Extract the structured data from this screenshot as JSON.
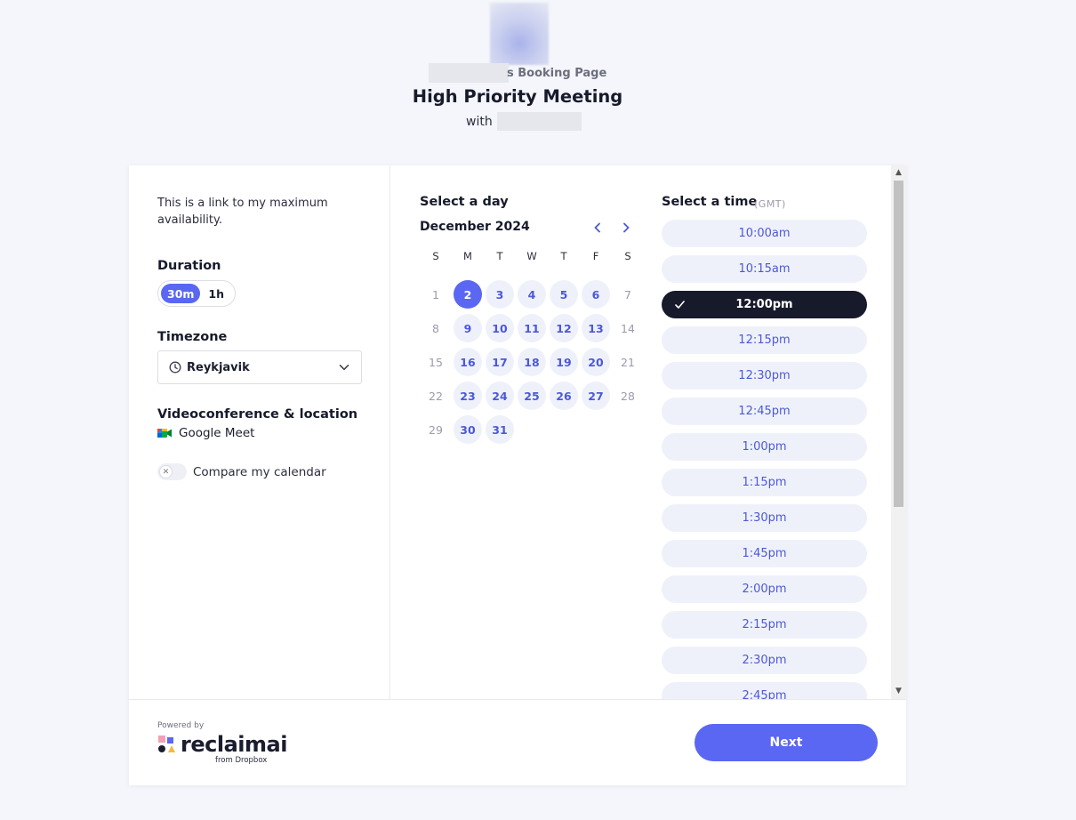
{
  "header": {
    "booking_page_title": "s Booking Page",
    "meeting_title": "High Priority Meeting",
    "with_label": "with"
  },
  "left": {
    "description": "This is a link to my maximum availability.",
    "duration_label": "Duration",
    "duration_options": [
      "30m",
      "1h"
    ],
    "duration_selected": "30m",
    "timezone_label": "Timezone",
    "timezone_value": "Reykjavik",
    "video_label": "Videoconference & location",
    "video_value": "Google Meet",
    "compare_label": "Compare my calendar"
  },
  "calendar": {
    "title": "Select a day",
    "month": "December 2024",
    "weekdays": [
      "S",
      "M",
      "T",
      "W",
      "T",
      "F",
      "S"
    ],
    "selected_day": 2,
    "days": [
      {
        "d": "1",
        "s": "disabled"
      },
      {
        "d": "2",
        "s": "selected"
      },
      {
        "d": "3",
        "s": "available"
      },
      {
        "d": "4",
        "s": "available"
      },
      {
        "d": "5",
        "s": "available"
      },
      {
        "d": "6",
        "s": "available"
      },
      {
        "d": "7",
        "s": "disabled"
      },
      {
        "d": "8",
        "s": "disabled"
      },
      {
        "d": "9",
        "s": "available"
      },
      {
        "d": "10",
        "s": "available"
      },
      {
        "d": "11",
        "s": "available"
      },
      {
        "d": "12",
        "s": "available"
      },
      {
        "d": "13",
        "s": "available"
      },
      {
        "d": "14",
        "s": "disabled"
      },
      {
        "d": "15",
        "s": "disabled"
      },
      {
        "d": "16",
        "s": "available"
      },
      {
        "d": "17",
        "s": "available"
      },
      {
        "d": "18",
        "s": "available"
      },
      {
        "d": "19",
        "s": "available"
      },
      {
        "d": "20",
        "s": "available"
      },
      {
        "d": "21",
        "s": "disabled"
      },
      {
        "d": "22",
        "s": "disabled"
      },
      {
        "d": "23",
        "s": "available"
      },
      {
        "d": "24",
        "s": "available"
      },
      {
        "d": "25",
        "s": "available"
      },
      {
        "d": "26",
        "s": "available"
      },
      {
        "d": "27",
        "s": "available"
      },
      {
        "d": "28",
        "s": "disabled"
      },
      {
        "d": "29",
        "s": "disabled"
      },
      {
        "d": "30",
        "s": "available"
      },
      {
        "d": "31",
        "s": "available"
      }
    ]
  },
  "times": {
    "title": "Select a time",
    "timezone_abbr": "(GMT)",
    "selected": "12:00pm",
    "slots": [
      "10:00am",
      "10:15am",
      "12:00pm",
      "12:15pm",
      "12:30pm",
      "12:45pm",
      "1:00pm",
      "1:15pm",
      "1:30pm",
      "1:45pm",
      "2:00pm",
      "2:15pm",
      "2:30pm",
      "2:45pm"
    ]
  },
  "footer": {
    "powered_by": "Powered by",
    "logo_text": "reclaimai",
    "logo_sub": "from Dropbox",
    "next_label": "Next"
  },
  "colors": {
    "accent": "#5a67f2",
    "slot_bg": "#eff1fa",
    "slot_text": "#4b59d8",
    "active_slot_bg": "#161a2b"
  },
  "icons": [
    "clock-icon",
    "chevron-down-icon",
    "chevron-left-icon",
    "chevron-right-icon",
    "check-icon",
    "google-meet-icon",
    "close-icon",
    "reclaim-logo-icon"
  ]
}
